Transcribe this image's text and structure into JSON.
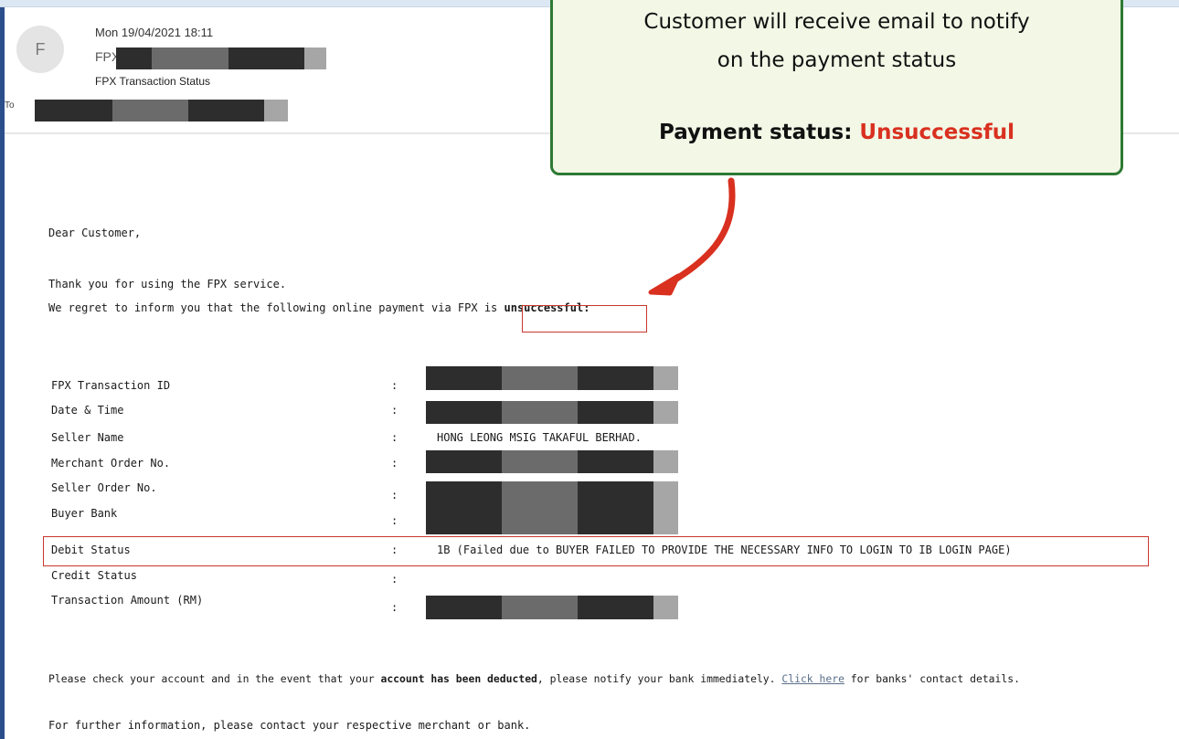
{
  "email_header": {
    "avatar_initial": "F",
    "date": "Mon 19/04/2021 18:11",
    "sender_prefix": "FPX",
    "subject": "FPX Transaction Status",
    "to_label": "To"
  },
  "callout": {
    "line1": "Customer will receive email to notify",
    "line2": "on the payment status",
    "status_label": "Payment status:",
    "status_value": "Unsuccessful",
    "accent_color": "#2c7a33",
    "status_color": "#d9301f"
  },
  "body": {
    "greeting": "Dear Customer,",
    "thanks": "Thank you for using the FPX service.",
    "regret_prefix": "We regret to inform you that the following online payment via FPX is ",
    "regret_bold": "unsuccessful",
    "regret_suffix": ":",
    "deducted_1": "Please check your account and in the event that your ",
    "deducted_bold": "account has been deducted",
    "deducted_2": ", please notify your bank immediately. ",
    "link_text": "Click here",
    "deducted_3": " for banks' contact details.",
    "further": "For further information, please contact your respective merchant or bank."
  },
  "details": {
    "separator": ":",
    "rows": [
      {
        "label": "FPX Transaction ID",
        "value": ""
      },
      {
        "label": "Date & Time",
        "value": ""
      },
      {
        "label": "Seller Name",
        "value": "HONG LEONG MSIG TAKAFUL BERHAD."
      },
      {
        "label": "Merchant Order No.",
        "value": ""
      },
      {
        "label": "Seller Order No.",
        "value": ""
      },
      {
        "label": "Buyer Bank",
        "value": ""
      },
      {
        "label": "Debit Status",
        "value": "1B (Failed due to BUYER FAILED TO PROVIDE THE NECESSARY INFO TO LOGIN TO IB LOGIN PAGE)"
      },
      {
        "label": "Credit Status",
        "value": ""
      },
      {
        "label": "Transaction Amount (RM)",
        "value": ""
      }
    ]
  }
}
